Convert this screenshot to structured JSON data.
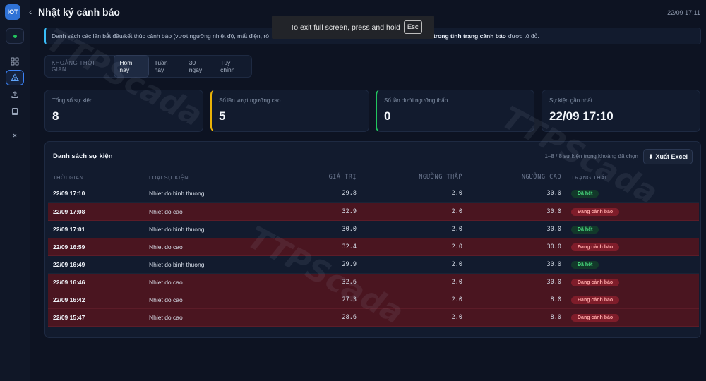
{
  "app": {
    "logo_text": "IOT",
    "title": "Nhật ký cảnh báo",
    "clock": "22/09 17:11"
  },
  "banner": {
    "text_start": "Danh sách các lần bắt đầu/kết thúc cảnh báo (vượt ngưỡng nhiệt độ, mất điện, rò",
    "text_bold": "trong tình trạng cảnh báo",
    "text_end": "được tô đỏ."
  },
  "overlay": {
    "message": "To exit full screen, press and hold",
    "key": "Esc"
  },
  "filter": {
    "label": "KHOẢNG THỜI GIAN",
    "options": [
      "Hôm nay",
      "Tuần này",
      "30 ngày",
      "Tùy chỉnh"
    ],
    "selected": "Hôm nay"
  },
  "stats": [
    {
      "label": "Tổng số sự kiện",
      "value": "8"
    },
    {
      "label": "Số lần vượt ngưỡng cao",
      "value": "5"
    },
    {
      "label": "Số lần dưới ngưỡng thấp",
      "value": "0"
    },
    {
      "label": "Sự kiện gần nhất",
      "value": "22/09 17:10"
    }
  ],
  "events": {
    "title": "Danh sách sự kiện",
    "summary": "1–8 / 8 sự kiện trong khoảng đã chọn",
    "export_label": "Xuất Excel",
    "columns": [
      "THỜI GIAN",
      "LOẠI SỰ KIỆN",
      "GIÁ TRỊ",
      "NGƯỠNG THẤP",
      "NGƯỠNG CAO",
      "TRẠNG THÁI"
    ],
    "rows": [
      {
        "time": "22/09 17:10",
        "type": "Nhiet do binh thuong",
        "value": "29.8",
        "low": "2.0",
        "high": "30.0",
        "status": "Đã hết",
        "alarm": false
      },
      {
        "time": "22/09 17:08",
        "type": "Nhiet do cao",
        "value": "32.9",
        "low": "2.0",
        "high": "30.0",
        "status": "Đang cảnh báo",
        "alarm": true
      },
      {
        "time": "22/09 17:01",
        "type": "Nhiet do binh thuong",
        "value": "30.0",
        "low": "2.0",
        "high": "30.0",
        "status": "Đã hết",
        "alarm": false
      },
      {
        "time": "22/09 16:59",
        "type": "Nhiet do cao",
        "value": "32.4",
        "low": "2.0",
        "high": "30.0",
        "status": "Đang cảnh báo",
        "alarm": true
      },
      {
        "time": "22/09 16:49",
        "type": "Nhiet do binh thuong",
        "value": "29.9",
        "low": "2.0",
        "high": "30.0",
        "status": "Đã hết",
        "alarm": false
      },
      {
        "time": "22/09 16:46",
        "type": "Nhiet do cao",
        "value": "32.6",
        "low": "2.0",
        "high": "30.0",
        "status": "Đang cảnh báo",
        "alarm": true
      },
      {
        "time": "22/09 16:42",
        "type": "Nhiet do cao",
        "value": "27.3",
        "low": "2.0",
        "high": "8.0",
        "status": "Đang cảnh báo",
        "alarm": true
      },
      {
        "time": "22/09 15:47",
        "type": "Nhiet do cao",
        "value": "28.6",
        "low": "2.0",
        "high": "8.0",
        "status": "Đang cảnh báo",
        "alarm": true
      }
    ]
  },
  "watermark": "TTPScada",
  "colors": {
    "background": "#0d1322",
    "accent": "#3b82f6",
    "alarm_row": "#4a1520",
    "ok_badge": "#4ade80",
    "warn_badge": "#fca5a5"
  }
}
